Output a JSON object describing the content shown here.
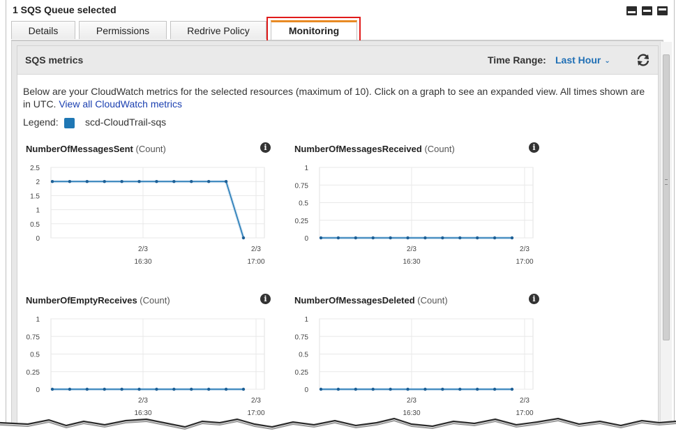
{
  "window": {
    "title": "1 SQS Queue selected"
  },
  "tabs": [
    {
      "label": "Details",
      "active": false
    },
    {
      "label": "Permissions",
      "active": false
    },
    {
      "label": "Redrive Policy",
      "active": false
    },
    {
      "label": "Monitoring",
      "active": true
    }
  ],
  "panel": {
    "title": "SQS metrics",
    "time_range_label": "Time Range:",
    "time_range_value": "Last Hour",
    "description": "Below are your CloudWatch metrics for the selected resources (maximum of 10). Click on a graph to see an expanded view. All times shown are in UTC.",
    "view_all_link": "View all CloudWatch metrics",
    "legend_label": "Legend:",
    "legend_series": "scd-CloudTrail-sqs"
  },
  "colors": {
    "series": "#1f77b4",
    "accent_tab": "#e88a24",
    "link": "#1f6fb5",
    "highlight": "#e01b1b"
  },
  "icons": [
    "window-layout-icon",
    "refresh-icon",
    "info-icon",
    "chevron-down-icon"
  ],
  "chart_data": [
    {
      "type": "line",
      "title": "NumberOfMessagesSent",
      "unit": "(Count)",
      "yticks": [
        "2.5",
        "2",
        "1.5",
        "1",
        "0.5",
        "0"
      ],
      "ylim": [
        0,
        2.5
      ],
      "xtick_labels": [
        [
          "2/3",
          "16:30"
        ],
        [
          "2/3",
          "17:00"
        ]
      ],
      "series": [
        {
          "name": "scd-CloudTrail-sqs",
          "values": [
            2,
            2,
            2,
            2,
            2,
            2,
            2,
            2,
            2,
            2,
            2,
            0
          ]
        }
      ]
    },
    {
      "type": "line",
      "title": "NumberOfMessagesReceived",
      "unit": "(Count)",
      "yticks": [
        "1",
        "0.75",
        "0.5",
        "0.25",
        "0"
      ],
      "ylim": [
        0,
        1
      ],
      "xtick_labels": [
        [
          "2/3",
          "16:30"
        ],
        [
          "2/3",
          "17:00"
        ]
      ],
      "series": [
        {
          "name": "scd-CloudTrail-sqs",
          "values": [
            0,
            0,
            0,
            0,
            0,
            0,
            0,
            0,
            0,
            0,
            0,
            0
          ]
        }
      ]
    },
    {
      "type": "line",
      "title": "NumberOfEmptyReceives",
      "unit": "(Count)",
      "yticks": [
        "1",
        "0.75",
        "0.5",
        "0.25",
        "0"
      ],
      "ylim": [
        0,
        1
      ],
      "xtick_labels": [
        [
          "2/3",
          "16:30"
        ],
        [
          "2/3",
          "17:00"
        ]
      ],
      "series": [
        {
          "name": "scd-CloudTrail-sqs",
          "values": [
            0,
            0,
            0,
            0,
            0,
            0,
            0,
            0,
            0,
            0,
            0,
            0
          ]
        }
      ]
    },
    {
      "type": "line",
      "title": "NumberOfMessagesDeleted",
      "unit": "(Count)",
      "yticks": [
        "1",
        "0.75",
        "0.5",
        "0.25",
        "0"
      ],
      "ylim": [
        0,
        1
      ],
      "xtick_labels": [
        [
          "2/3",
          "16:30"
        ],
        [
          "2/3",
          "17:00"
        ]
      ],
      "series": [
        {
          "name": "scd-CloudTrail-sqs",
          "values": [
            0,
            0,
            0,
            0,
            0,
            0,
            0,
            0,
            0,
            0,
            0,
            0
          ]
        }
      ]
    }
  ]
}
